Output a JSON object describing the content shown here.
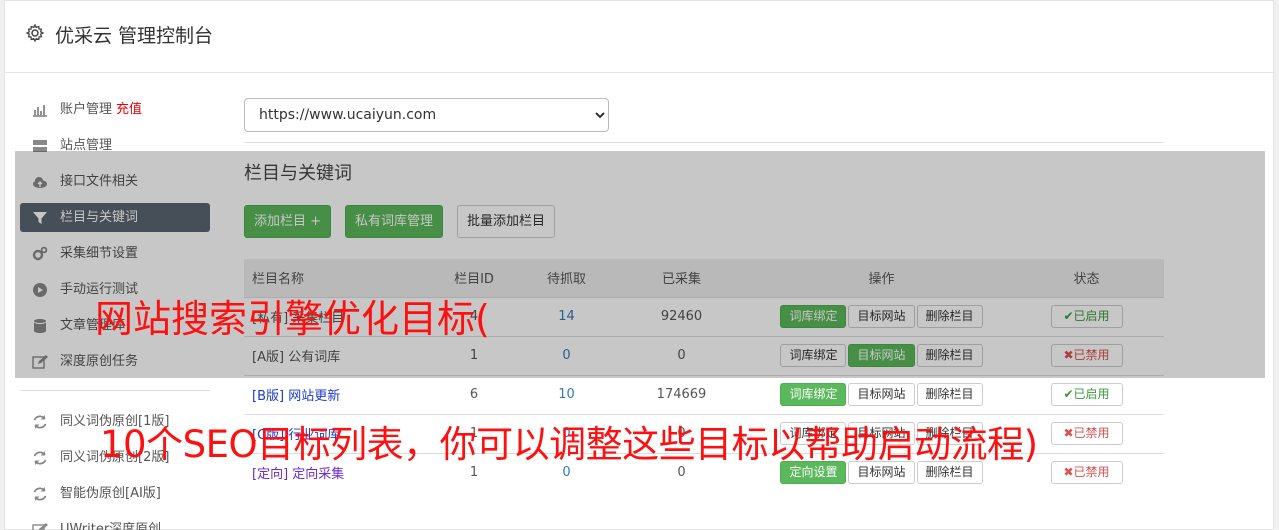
{
  "header": {
    "title": "优采云 管理控制台"
  },
  "sidebar": {
    "items": [
      {
        "icon": "bar-chart-icon",
        "label": "账户管理",
        "highlight": "充值"
      },
      {
        "icon": "server-icon",
        "label": "站点管理"
      },
      {
        "icon": "cloud-upload-icon",
        "label": "接口文件相关"
      },
      {
        "icon": "filter-icon",
        "label": "栏目与关键词",
        "active": true
      },
      {
        "icon": "cogs-icon",
        "label": "采集细节设置"
      },
      {
        "icon": "play-circle-icon",
        "label": "手动运行测试"
      },
      {
        "icon": "database-icon",
        "label": "文章管理库"
      },
      {
        "icon": "edit-icon",
        "label": "深度原创任务"
      }
    ],
    "items2": [
      {
        "icon": "refresh-icon",
        "label": "同义词伪原创[1版]"
      },
      {
        "icon": "refresh-icon",
        "label": "同义词伪原创[2版]"
      },
      {
        "icon": "refresh-icon",
        "label": "智能伪原创[AI版]"
      },
      {
        "icon": "edit-icon",
        "label": "UWriter深度原创"
      }
    ]
  },
  "main": {
    "site_select": {
      "value": "https://www.ucaiyun.com"
    },
    "section_title": "栏目与关键词",
    "buttons": {
      "add_column": "添加栏目 +",
      "private_lib": "私有词库管理",
      "batch_add": "批量添加栏目"
    },
    "table": {
      "headers": [
        "栏目名称",
        "栏目ID",
        "待抓取",
        "已采集",
        "操作",
        "状态"
      ],
      "rows": [
        {
          "tag": "[私有]",
          "name": "采集栏目",
          "id": "4",
          "pending": "14",
          "collected": "92460",
          "op1": "词库绑定",
          "op2": "目标网站",
          "op3": "删除栏目",
          "status": "已启用",
          "enabled": true
        },
        {
          "tag": "[A版]",
          "name": "公有词库",
          "id": "1",
          "pending": "0",
          "collected": "0",
          "op1": "词库绑定",
          "op2": "目标网站",
          "op3": "删除栏目",
          "status": "已禁用",
          "enabled": false
        },
        {
          "tag": "[B版]",
          "name": "网站更新",
          "id": "6",
          "pending": "10",
          "collected": "174669",
          "op1": "词库绑定",
          "op2": "目标网站",
          "op3": "删除栏目",
          "status": "已启用",
          "enabled": true
        },
        {
          "tag": "[C版]",
          "name": "行业词库",
          "id": "1",
          "pending": "0",
          "collected": "0",
          "op1": "词库绑定",
          "op2": "目标网站",
          "op3": "删除栏目",
          "status": "已禁用",
          "enabled": false
        },
        {
          "tag": "[定向]",
          "name": "定向采集",
          "id": "1",
          "pending": "0",
          "collected": "0",
          "op1": "定向设置",
          "op2": "目标网站",
          "op3": "删除栏目",
          "status": "已禁用",
          "enabled": false
        }
      ]
    }
  },
  "overlay_caption": {
    "line1": "网站搜索引擎优化目标(",
    "line2": "10个SEO目标列表，你可以调整这些目标以帮助启动流程)"
  },
  "colors": {
    "accent_green": "#5cb85c",
    "active_nav": "#5a6570",
    "caption_red": "#ff1010"
  }
}
